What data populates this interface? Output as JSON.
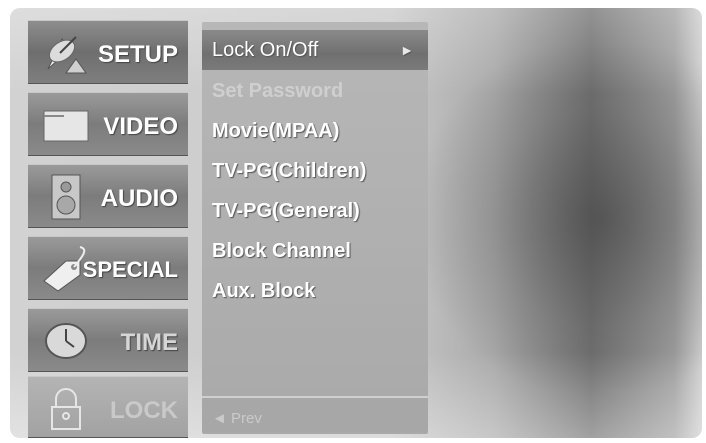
{
  "menu": {
    "categories": [
      {
        "label": "SETUP",
        "icon": "satellite-dish-icon"
      },
      {
        "label": "VIDEO",
        "icon": "screen-icon"
      },
      {
        "label": "AUDIO",
        "icon": "speaker-icon"
      },
      {
        "label": "SPECIAL",
        "icon": "tag-icon"
      },
      {
        "label": "TIME",
        "icon": "clock-icon"
      },
      {
        "label": "LOCK",
        "icon": "padlock-icon"
      }
    ],
    "items": [
      {
        "label": "Lock On/Off",
        "arrow": "►"
      },
      {
        "label": "Set Password"
      },
      {
        "label": "Movie(MPAA)"
      },
      {
        "label": "TV-PG(Children)"
      },
      {
        "label": "TV-PG(General)"
      },
      {
        "label": "Block Channel"
      },
      {
        "label": "Aux. Block"
      }
    ],
    "prev_label": "◄ Prev"
  }
}
